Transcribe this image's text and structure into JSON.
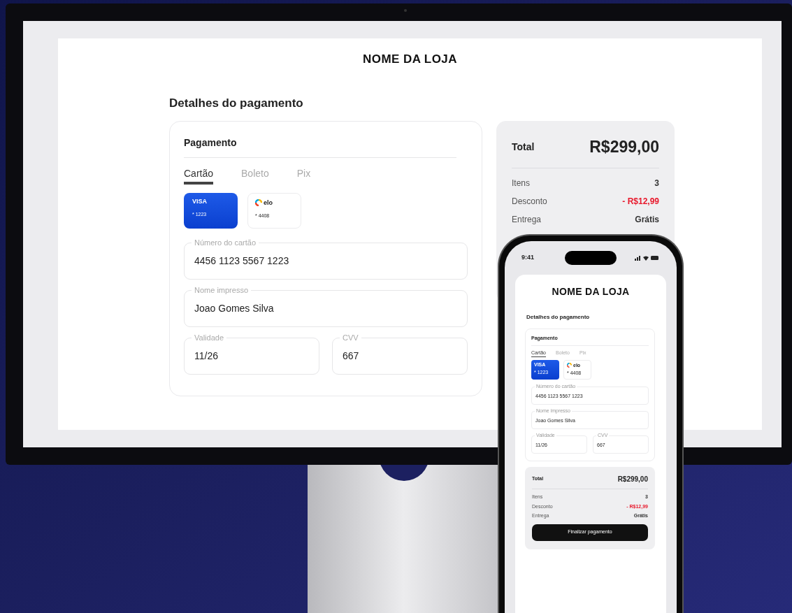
{
  "monitor": {
    "store_name": "NOME DA LOJA",
    "heading": "Detalhes do pagamento",
    "payment": {
      "title": "Pagamento",
      "tabs": [
        {
          "label": "Cartão",
          "selected": true
        },
        {
          "label": "Boleto",
          "selected": false
        },
        {
          "label": "Pix",
          "selected": false
        }
      ],
      "cards": [
        {
          "brand": "VISA",
          "kind": "visa",
          "number": "* 1223",
          "selected": true
        },
        {
          "brand": "elo",
          "kind": "elo",
          "number": "* 4408",
          "selected": false
        }
      ],
      "fields": [
        {
          "label": "Número do cartão",
          "value": "4456 1123 5567 1223"
        },
        {
          "label": "Nome impresso",
          "value": "Joao Gomes Silva"
        },
        {
          "label": "Validade",
          "value": "11/26"
        },
        {
          "label": "CVV",
          "value": "667"
        }
      ]
    },
    "summary": {
      "total_label": "Total",
      "total_value": "R$299,00",
      "rows": [
        {
          "label": "Itens",
          "value": "3",
          "kind": "plain"
        },
        {
          "label": "Desconto",
          "value": "- R$12,99",
          "kind": "discount"
        },
        {
          "label": "Entrega",
          "value": "Grátis",
          "kind": "plain"
        }
      ]
    }
  },
  "phone": {
    "time": "9:41",
    "store_name": "NOME DA LOJA",
    "heading": "Detalhes do pagamento",
    "payment": {
      "title": "Pagamento",
      "tabs": [
        {
          "label": "Cartão",
          "selected": true
        },
        {
          "label": "Boleto",
          "selected": false
        },
        {
          "label": "Pix",
          "selected": false
        }
      ],
      "cards": [
        {
          "brand": "VISA",
          "kind": "visa",
          "number": "* 1223",
          "selected": true
        },
        {
          "brand": "elo",
          "kind": "elo",
          "number": "* 4408",
          "selected": false
        }
      ],
      "fields": [
        {
          "label": "Número do cartão",
          "value": "4456 1123 5567 1223"
        },
        {
          "label": "Nome impresso",
          "value": "Joao Gomes Silva"
        },
        {
          "label": "Validade",
          "value": "11/26"
        },
        {
          "label": "CVV",
          "value": "667"
        }
      ]
    },
    "summary": {
      "total_label": "Total",
      "total_value": "R$299,00",
      "rows": [
        {
          "label": "Itens",
          "value": "3",
          "kind": "plain"
        },
        {
          "label": "Desconto",
          "value": "- R$12,99",
          "kind": "discount"
        },
        {
          "label": "Entrega",
          "value": "Grátis",
          "kind": "plain"
        }
      ],
      "button": "Finalizar pagamento"
    }
  }
}
